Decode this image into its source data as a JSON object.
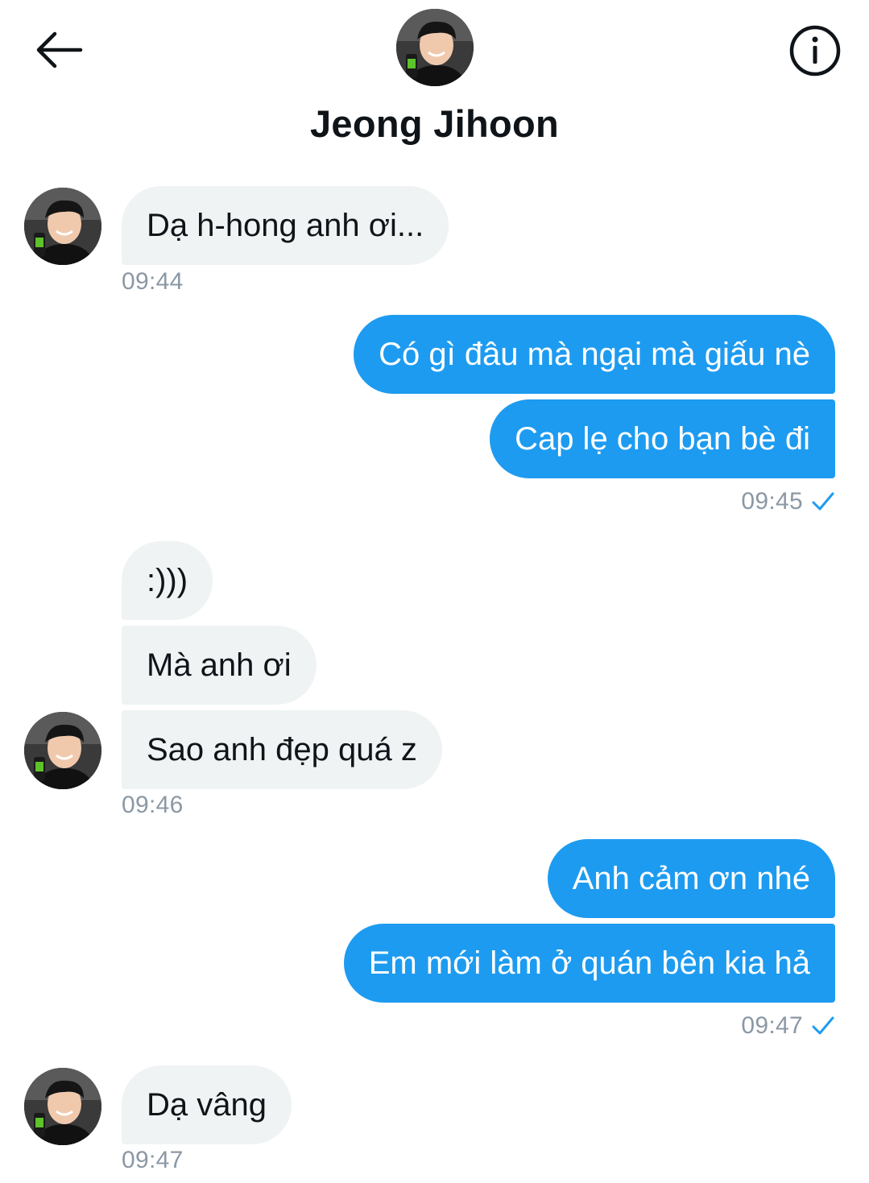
{
  "header": {
    "contact_name": "Jeong Jihoon",
    "back_icon": "arrow-left-icon",
    "info_icon": "info-icon"
  },
  "colors": {
    "outgoing_bubble": "#1d9bf0",
    "incoming_bubble": "#eff3f4",
    "timestamp": "#8b98a5",
    "read_check": "#1d9bf0"
  },
  "messages": [
    {
      "direction": "incoming",
      "text": "Dạ h-hong anh ơi..."
    },
    {
      "direction": "outgoing",
      "text": "Có gì đâu mà ngại mà giấu nè"
    },
    {
      "direction": "outgoing",
      "text": "Cap lẹ cho bạn bè đi"
    },
    {
      "direction": "incoming",
      "text": ":)))"
    },
    {
      "direction": "incoming",
      "text": "Mà anh ơi"
    },
    {
      "direction": "incoming",
      "text": "Sao anh đẹp quá z"
    },
    {
      "direction": "outgoing",
      "text": "Anh cảm ơn nhé"
    },
    {
      "direction": "outgoing",
      "text": "Em mới làm ở quán bên kia hả"
    },
    {
      "direction": "incoming",
      "text": "Dạ vâng"
    }
  ],
  "timestamps": [
    "09:44",
    "09:45",
    "09:46",
    "09:47",
    "09:47"
  ]
}
